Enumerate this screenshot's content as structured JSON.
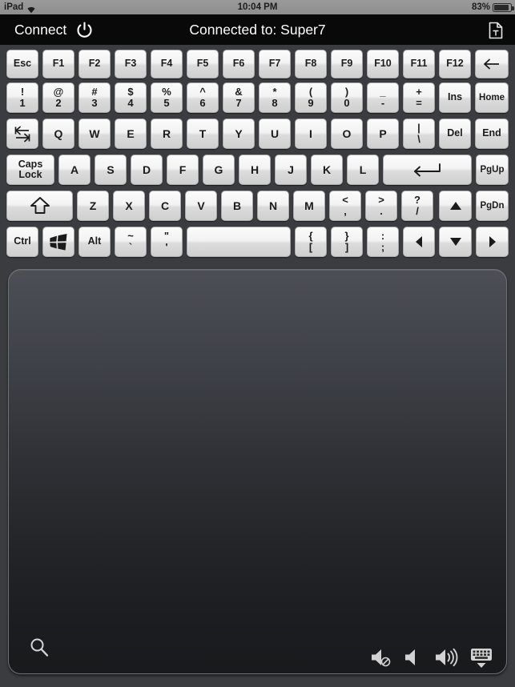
{
  "statusbar": {
    "carrier": "iPad",
    "wifi_icon": "wifi-icon",
    "time": "10:04 PM",
    "battery_percent": "83%",
    "battery_icon": "battery-icon"
  },
  "navbar": {
    "connect_label": "Connect",
    "power_icon": "power-icon",
    "title": "Connected to: Super7",
    "document_icon": "text-document-icon"
  },
  "colors": {
    "background": "#3a3c40",
    "navbar_bg": "#090909",
    "statusbar_bg": "#909090",
    "key_face_light": "#fbfbfb",
    "key_face_dark": "#cfcfcf",
    "key_text": "#1b1b1b",
    "trackpad_top": "#4c4f55",
    "trackpad_bottom": "#191a1c",
    "icon_white": "#d8d8d8"
  },
  "keyboard": {
    "rows": [
      {
        "name": "function-row",
        "keys": [
          {
            "name": "esc",
            "label": "Esc"
          },
          {
            "name": "f1",
            "label": "F1"
          },
          {
            "name": "f2",
            "label": "F2"
          },
          {
            "name": "f3",
            "label": "F3"
          },
          {
            "name": "f4",
            "label": "F4"
          },
          {
            "name": "f5",
            "label": "F5"
          },
          {
            "name": "f6",
            "label": "F6"
          },
          {
            "name": "f7",
            "label": "F7"
          },
          {
            "name": "f8",
            "label": "F8"
          },
          {
            "name": "f9",
            "label": "F9"
          },
          {
            "name": "f10",
            "label": "F10"
          },
          {
            "name": "f11",
            "label": "F11"
          },
          {
            "name": "f12",
            "label": "F12"
          },
          {
            "name": "backspace",
            "label": "",
            "icon": "backspace-arrow-icon"
          }
        ]
      },
      {
        "name": "number-row",
        "keys": [
          {
            "name": "1",
            "top": "!",
            "bottom": "1"
          },
          {
            "name": "2",
            "top": "@",
            "bottom": "2"
          },
          {
            "name": "3",
            "top": "#",
            "bottom": "3"
          },
          {
            "name": "4",
            "top": "$",
            "bottom": "4"
          },
          {
            "name": "5",
            "top": "%",
            "bottom": "5"
          },
          {
            "name": "6",
            "top": "^",
            "bottom": "6"
          },
          {
            "name": "7",
            "top": "&",
            "bottom": "7"
          },
          {
            "name": "8",
            "top": "*",
            "bottom": "8"
          },
          {
            "name": "9",
            "top": "(",
            "bottom": "9"
          },
          {
            "name": "0",
            "top": ")",
            "bottom": "0"
          },
          {
            "name": "minus",
            "top": "_",
            "bottom": "-"
          },
          {
            "name": "equals",
            "top": "+",
            "bottom": "="
          },
          {
            "name": "ins",
            "label": "Ins"
          },
          {
            "name": "home",
            "label": "Home"
          }
        ]
      },
      {
        "name": "qwerty-row",
        "keys": [
          {
            "name": "tab",
            "label": "",
            "icon": "tab-arrows-icon"
          },
          {
            "name": "q",
            "label": "Q"
          },
          {
            "name": "w",
            "label": "W"
          },
          {
            "name": "e",
            "label": "E"
          },
          {
            "name": "r",
            "label": "R"
          },
          {
            "name": "t",
            "label": "T"
          },
          {
            "name": "y",
            "label": "Y"
          },
          {
            "name": "u",
            "label": "U"
          },
          {
            "name": "i",
            "label": "I"
          },
          {
            "name": "o",
            "label": "O"
          },
          {
            "name": "p",
            "label": "P"
          },
          {
            "name": "backslash",
            "top": "|",
            "bottom": "\\"
          },
          {
            "name": "del",
            "label": "Del"
          },
          {
            "name": "end",
            "label": "End"
          }
        ]
      },
      {
        "name": "home-row",
        "keys": [
          {
            "name": "caps-lock",
            "top": "Caps",
            "bottom": "Lock"
          },
          {
            "name": "a",
            "label": "A"
          },
          {
            "name": "s",
            "label": "S"
          },
          {
            "name": "d",
            "label": "D"
          },
          {
            "name": "f",
            "label": "F"
          },
          {
            "name": "g",
            "label": "G"
          },
          {
            "name": "h",
            "label": "H"
          },
          {
            "name": "j",
            "label": "J"
          },
          {
            "name": "k",
            "label": "K"
          },
          {
            "name": "l",
            "label": "L"
          },
          {
            "name": "enter",
            "label": "",
            "icon": "enter-arrow-icon"
          },
          {
            "name": "pgup",
            "label": "PgUp"
          }
        ]
      },
      {
        "name": "shift-row",
        "keys": [
          {
            "name": "shift",
            "label": "",
            "icon": "shift-arrow-icon"
          },
          {
            "name": "z",
            "label": "Z"
          },
          {
            "name": "x",
            "label": "X"
          },
          {
            "name": "c",
            "label": "C"
          },
          {
            "name": "v",
            "label": "V"
          },
          {
            "name": "b",
            "label": "B"
          },
          {
            "name": "n",
            "label": "N"
          },
          {
            "name": "m",
            "label": "M"
          },
          {
            "name": "comma",
            "top": "<",
            "bottom": ","
          },
          {
            "name": "period",
            "top": ">",
            "bottom": "."
          },
          {
            "name": "slash",
            "top": "?",
            "bottom": "/"
          },
          {
            "name": "arrow-up",
            "label": "",
            "icon": "arrow-up-icon"
          },
          {
            "name": "pgdn",
            "label": "PgDn"
          }
        ]
      },
      {
        "name": "bottom-row",
        "keys": [
          {
            "name": "ctrl",
            "label": "Ctrl"
          },
          {
            "name": "windows",
            "label": "",
            "icon": "windows-logo-icon"
          },
          {
            "name": "alt",
            "label": "Alt"
          },
          {
            "name": "backtick",
            "top": "~",
            "bottom": "`"
          },
          {
            "name": "quote",
            "top": "\"",
            "bottom": "'"
          },
          {
            "name": "space",
            "label": ""
          },
          {
            "name": "bracket-left",
            "top": "{",
            "bottom": "["
          },
          {
            "name": "bracket-right",
            "top": "}",
            "bottom": "]"
          },
          {
            "name": "semicolon",
            "top": ":",
            "bottom": ";"
          },
          {
            "name": "arrow-left",
            "label": "",
            "icon": "arrow-left-icon"
          },
          {
            "name": "arrow-down",
            "label": "",
            "icon": "arrow-down-icon"
          },
          {
            "name": "arrow-right",
            "label": "",
            "icon": "arrow-right-icon"
          }
        ]
      }
    ]
  },
  "trackpad": {
    "search_icon": "search-magnifier-icon"
  },
  "bottombar": {
    "icons": [
      {
        "name": "volume-mute-icon"
      },
      {
        "name": "volume-down-icon"
      },
      {
        "name": "volume-up-icon"
      },
      {
        "name": "hide-keyboard-icon"
      }
    ]
  }
}
